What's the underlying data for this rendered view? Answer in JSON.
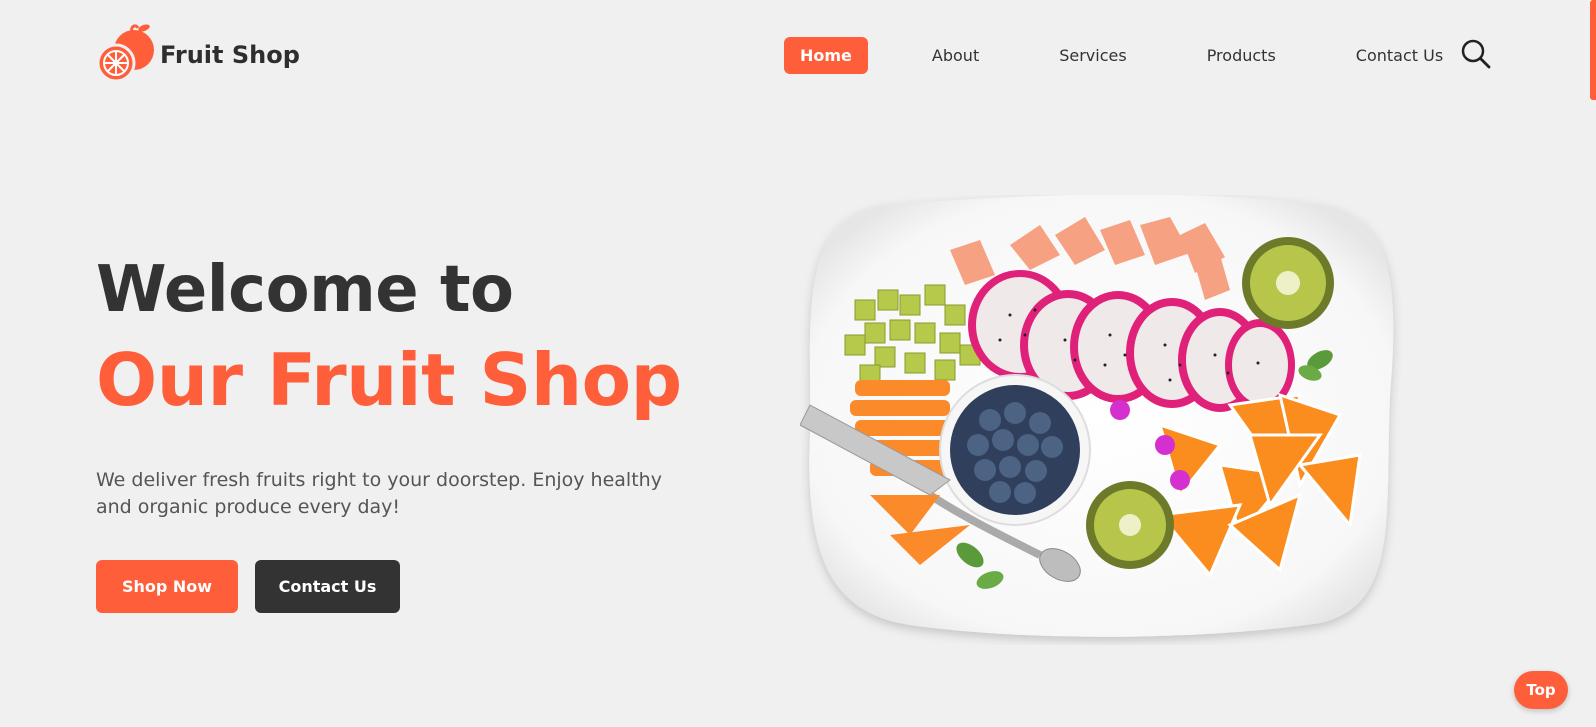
{
  "brand": {
    "name": "Fruit Shop",
    "logo_icon": "orange-fruit-icon",
    "accent_color": "#ff5e3a"
  },
  "nav": {
    "items": [
      {
        "label": "Home",
        "active": true
      },
      {
        "label": "About",
        "active": false
      },
      {
        "label": "Services",
        "active": false
      },
      {
        "label": "Products",
        "active": false
      },
      {
        "label": "Contact Us",
        "active": false
      }
    ],
    "search_icon": "search-icon"
  },
  "hero": {
    "title_line1": "Welcome to",
    "title_line2": "Our Fruit Shop",
    "description": "We deliver fresh fruits right to your doorstep. Enjoy healthy and organic produce every day!",
    "primary_button": "Shop Now",
    "secondary_button": "Contact Us",
    "image": "fruit-platter-image"
  },
  "back_to_top": {
    "label": "Top"
  }
}
